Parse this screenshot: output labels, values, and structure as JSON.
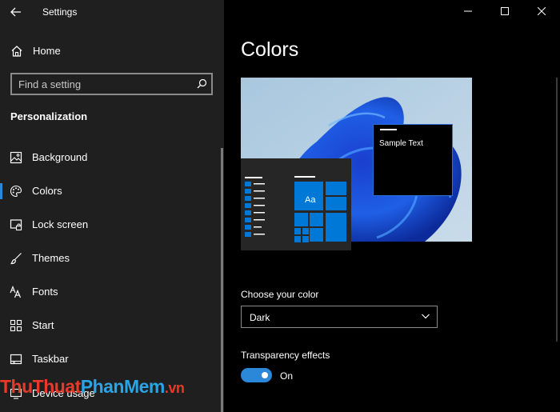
{
  "window": {
    "title": "Settings"
  },
  "sidebar": {
    "home_label": "Home",
    "search": {
      "placeholder": "Find a setting",
      "value": ""
    },
    "section_title": "Personalization",
    "items": [
      {
        "label": "Background",
        "icon": "image-icon",
        "selected": false
      },
      {
        "label": "Colors",
        "icon": "palette-icon",
        "selected": true
      },
      {
        "label": "Lock screen",
        "icon": "lock-screen-icon",
        "selected": false
      },
      {
        "label": "Themes",
        "icon": "brush-icon",
        "selected": false
      },
      {
        "label": "Fonts",
        "icon": "fonts-icon",
        "selected": false
      },
      {
        "label": "Start",
        "icon": "start-icon",
        "selected": false
      },
      {
        "label": "Taskbar",
        "icon": "taskbar-icon",
        "selected": false
      },
      {
        "label": "Device usage",
        "icon": "device-usage-icon",
        "selected": false
      }
    ]
  },
  "main": {
    "title": "Colors",
    "preview": {
      "sample_text": "Sample Text",
      "tile_label": "Aa"
    },
    "choose_color": {
      "label": "Choose your color",
      "selected": "Dark"
    },
    "transparency": {
      "label": "Transparency effects",
      "state": "On",
      "enabled": true
    }
  },
  "watermark": {
    "part1": "ThuThuat",
    "part2": "PhanMem",
    "part3": ".vn"
  },
  "colors": {
    "accent": "#2b88d8",
    "sidebar_bg": "#1f1f1f",
    "main_bg": "#000000",
    "tile_blue": "#0078d7"
  }
}
